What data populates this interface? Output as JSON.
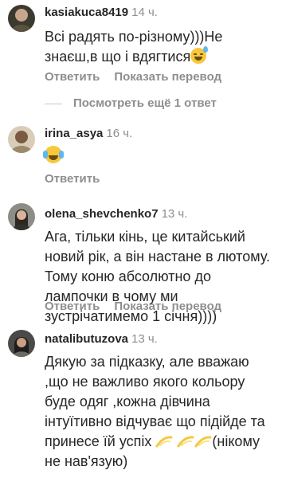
{
  "comments": [
    {
      "username": "kasiakuca8419",
      "time": "14 ч.",
      "text": "Всі радять по-різному)))Не знаєш,в що і вдягтися",
      "text_emoji": "grinning-face-with-sweat-emoji",
      "reply_label": "Ответить",
      "translate_label": "Показать перевод"
    },
    {
      "username": "irina_asya",
      "time": "16 ч.",
      "text": "",
      "text_emoji": "face-with-tears-of-joy-emoji",
      "reply_label": "Ответить"
    },
    {
      "username": "olena_shevchenko7",
      "time": "13 ч.",
      "text": "Ага, тільки кінь, це китайський новий рік, а він настане в лютому. Тому коню абсолютно до лампочки в чому ми зустрічатимемо 1 січня))))",
      "reply_label": "Ответить",
      "translate_label": "Показать перевод"
    },
    {
      "username": "natalibutuzova",
      "time": "13 ч.",
      "text": "Дякую за підказку, але вважаю ,що не  важливо якого кольору буде одяг ,кожна дівчина інтуїтивно відчуває що підійде та принесе їй успіх",
      "text_emoji": "dizzy-emoji",
      "text_end": "(нікому не нав'язую)"
    }
  ],
  "more_replies_label": "Посмотреть ещё 1 ответ",
  "colors": {
    "primary_text": "#262626",
    "secondary_text": "#8e8e8e",
    "divider": "#c7c7c7"
  }
}
